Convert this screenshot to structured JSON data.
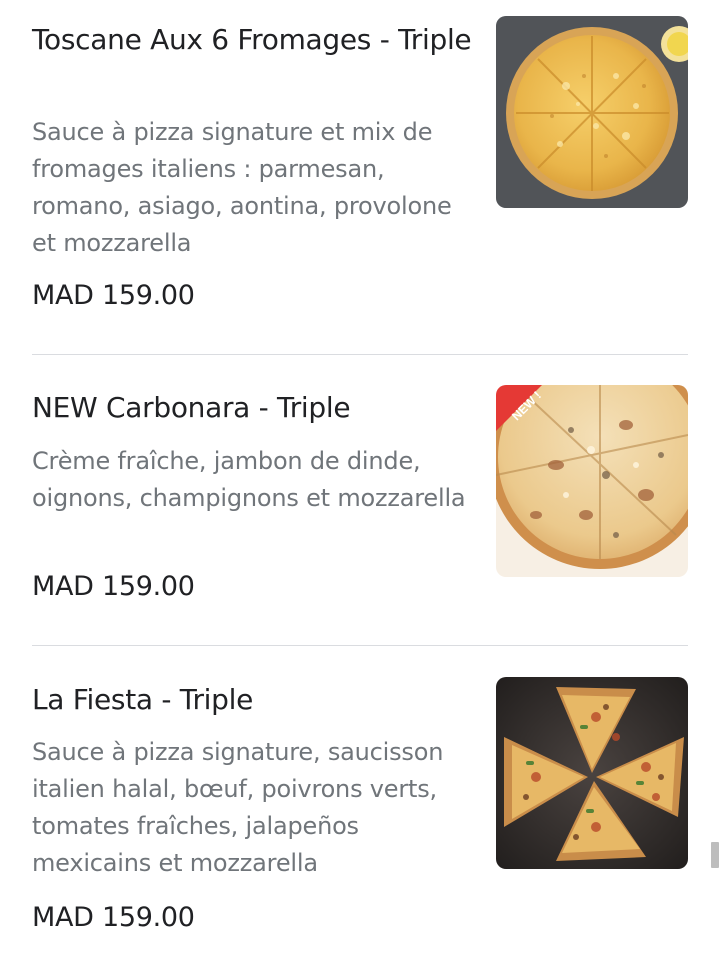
{
  "menu": {
    "items": [
      {
        "name": "Toscane Aux 6 Fromages - Triple",
        "description": "Sauce à pizza signature et mix de fromages italiens : parmesan, romano, asiago, aontina, provolone et mozzarella",
        "price": "MAD 159.00",
        "image": "pizza-cheese-photo"
      },
      {
        "name": "NEW Carbonara  - Triple",
        "description": "Crème fraîche, jambon de dinde, oignons, champignons et mozzarella",
        "price": "MAD 159.00",
        "image": "pizza-carbonara-photo",
        "badge": "NEW !"
      },
      {
        "name": "La Fiesta - Triple",
        "description": "Sauce à pizza signature, saucisson italien halal, bœuf, poivrons verts, tomates fraîches, jalapeños mexicains et mozzarella",
        "price": "MAD 159.00",
        "image": "pizza-fiesta-photo"
      }
    ]
  },
  "colors": {
    "title": "#202124",
    "description": "#70757a",
    "divider": "#dadce0",
    "badge": "#e53935"
  }
}
